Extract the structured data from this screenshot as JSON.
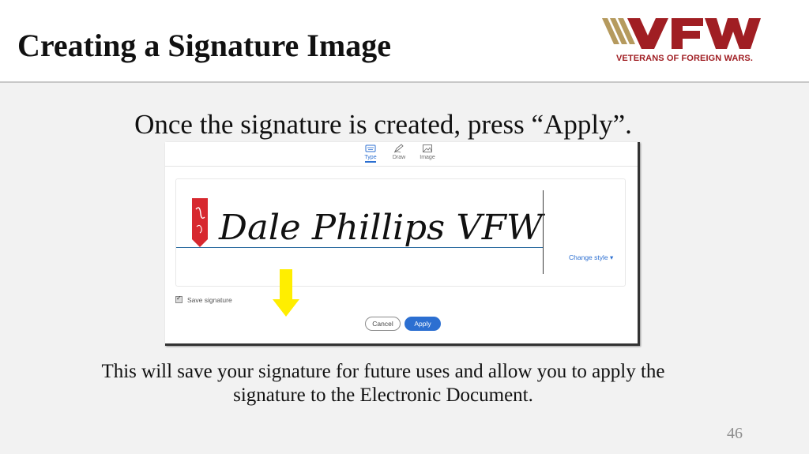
{
  "slide": {
    "title": "Creating a Signature Image",
    "instruction": "Once the signature is created, press “Apply”.",
    "footer_line1": "This will save your signature for future uses and allow you to apply the",
    "footer_line2": "signature to the Electronic Document.",
    "page_number": "46"
  },
  "logo": {
    "wordmark": "VFW",
    "tagline": "VETERANS OF FOREIGN WARS.",
    "colors": {
      "red": "#a01e23",
      "gold": "#b59a5e"
    }
  },
  "signature_dialog": {
    "tabs": [
      {
        "label": "Type",
        "icon": "keyboard-icon",
        "active": true
      },
      {
        "label": "Draw",
        "icon": "pen-icon",
        "active": false
      },
      {
        "label": "Image",
        "icon": "image-icon",
        "active": false
      }
    ],
    "signature_text": "Dale Phillips VFW",
    "change_style_label": "Change style ▾",
    "save_signature_label": "Save signature",
    "save_signature_checked": true,
    "cancel_label": "Cancel",
    "apply_label": "Apply",
    "accent_color": "#2c6fd1",
    "callout_arrow_color": "#ffee00"
  }
}
